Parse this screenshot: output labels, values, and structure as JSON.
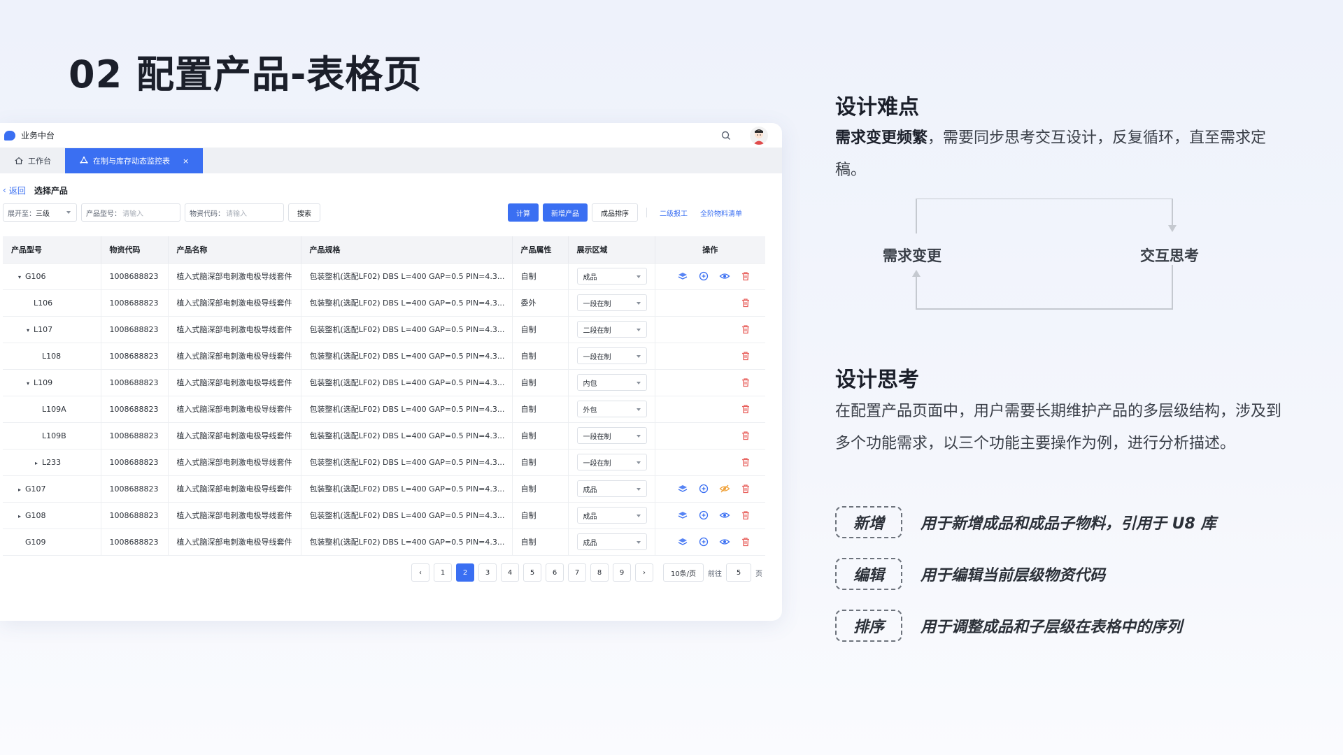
{
  "slide": {
    "title": "02 配置产品-表格页"
  },
  "app": {
    "title": "业务中台",
    "tabs": [
      {
        "label": "工作台"
      },
      {
        "label": "在制与库存动态监控表"
      }
    ],
    "breadcrumb": {
      "back": "返回",
      "current": "选择产品"
    },
    "filters": {
      "expand_label": "展开至：",
      "expand_value": "三级",
      "product_model_label": "产品型号：",
      "product_model_placeholder": "请输入",
      "material_code_label": "物资代码：",
      "material_code_placeholder": "请输入",
      "search_btn": "搜索"
    },
    "actions": {
      "calc": "计算",
      "add_product": "新增产品",
      "sort": "成品排序",
      "secondary": "二级报工",
      "bom": "全阶物料清单"
    },
    "columns": [
      "产品型号",
      "物资代码",
      "产品名称",
      "产品规格",
      "产品属性",
      "展示区域",
      "操作"
    ],
    "rows": [
      {
        "model": "G106",
        "tree": "▾",
        "level": 0,
        "code": "1008688823",
        "name": "植入式脑深部电刺激电极导线套件",
        "spec": "包装整机(选配LF02) DBS L=400 GAP=0.5 PIN=4.3...",
        "attr": "自制",
        "area": "成品",
        "ops": "full"
      },
      {
        "model": "L106",
        "tree": "",
        "level": 1,
        "code": "1008688823",
        "name": "植入式脑深部电刺激电极导线套件",
        "spec": "包装整机(选配LF02) DBS L=400 GAP=0.5 PIN=4.3...",
        "attr": "委外",
        "area": "一段在制",
        "ops": "del"
      },
      {
        "model": "L107",
        "tree": "▾",
        "level": 1,
        "code": "1008688823",
        "name": "植入式脑深部电刺激电极导线套件",
        "spec": "包装整机(选配LF02) DBS L=400 GAP=0.5 PIN=4.3...",
        "attr": "自制",
        "area": "二段在制",
        "ops": "del"
      },
      {
        "model": "L108",
        "tree": "",
        "level": 2,
        "code": "1008688823",
        "name": "植入式脑深部电刺激电极导线套件",
        "spec": "包装整机(选配LF02) DBS L=400 GAP=0.5 PIN=4.3...",
        "attr": "自制",
        "area": "一段在制",
        "ops": "del"
      },
      {
        "model": "L109",
        "tree": "▾",
        "level": 1,
        "code": "1008688823",
        "name": "植入式脑深部电刺激电极导线套件",
        "spec": "包装整机(选配LF02) DBS L=400 GAP=0.5 PIN=4.3...",
        "attr": "自制",
        "area": "内包",
        "ops": "del"
      },
      {
        "model": "L109A",
        "tree": "",
        "level": 2,
        "code": "1008688823",
        "name": "植入式脑深部电刺激电极导线套件",
        "spec": "包装整机(选配LF02) DBS L=400 GAP=0.5 PIN=4.3...",
        "attr": "自制",
        "area": "外包",
        "ops": "del"
      },
      {
        "model": "L109B",
        "tree": "",
        "level": 2,
        "code": "1008688823",
        "name": "植入式脑深部电刺激电极导线套件",
        "spec": "包装整机(选配LF02) DBS L=400 GAP=0.5 PIN=4.3...",
        "attr": "自制",
        "area": "一段在制",
        "ops": "del"
      },
      {
        "model": "L233",
        "tree": "▸",
        "level": 2,
        "code": "1008688823",
        "name": "植入式脑深部电刺激电极导线套件",
        "spec": "包装整机(选配LF02) DBS L=400 GAP=0.5 PIN=4.3...",
        "attr": "自制",
        "area": "一段在制",
        "ops": "del"
      },
      {
        "model": "G107",
        "tree": "▸",
        "level": 0,
        "code": "1008688823",
        "name": "植入式脑深部电刺激电极导线套件",
        "spec": "包装整机(选配LF02) DBS L=400 GAP=0.5 PIN=4.3...",
        "attr": "自制",
        "area": "成品",
        "ops": "full-hidden"
      },
      {
        "model": "G108",
        "tree": "▸",
        "level": 0,
        "code": "1008688823",
        "name": "植入式脑深部电刺激电极导线套件",
        "spec": "包装整机(选配LF02) DBS L=400 GAP=0.5 PIN=4.3...",
        "attr": "自制",
        "area": "成品",
        "ops": "full"
      },
      {
        "model": "G109",
        "tree": "",
        "level": 0,
        "code": "1008688823",
        "name": "植入式脑深部电刺激电极导线套件",
        "spec": "包装整机(选配LF02) DBS L=400 GAP=0.5 PIN=4.3...",
        "attr": "自制",
        "area": "成品",
        "ops": "full"
      }
    ],
    "pager": {
      "pages": [
        "1",
        "2",
        "3",
        "4",
        "5",
        "6",
        "7",
        "8",
        "9"
      ],
      "current": "2",
      "page_size": "10条/页",
      "goto_label": "前往",
      "goto_value": "5",
      "page_unit": "页"
    }
  },
  "side": {
    "difficulty_title": "设计难点",
    "difficulty_bold": "需求变更频繁",
    "difficulty_text": "，需要同步思考交互设计，反复循环，直至需求定稿。",
    "cycle_left": "需求变更",
    "cycle_right": "交互思考",
    "thinking_title": "设计思考",
    "thinking_text": "在配置产品页面中，用户需要长期维护产品的多层级结构，涉及到多个功能需求，以三个功能主要操作为例，进行分析描述。",
    "features": [
      {
        "tag": "新增",
        "desc": "用于新增成品和成品子物料，引用于 U8 库"
      },
      {
        "tag": "编辑",
        "desc": "用于编辑当前层级物资代码"
      },
      {
        "tag": "排序",
        "desc": "用于调整成品和子层级在表格中的序列"
      }
    ]
  },
  "colors": {
    "primary": "#3a6ff2",
    "danger": "#e8625e",
    "warning": "#f0a23b"
  }
}
